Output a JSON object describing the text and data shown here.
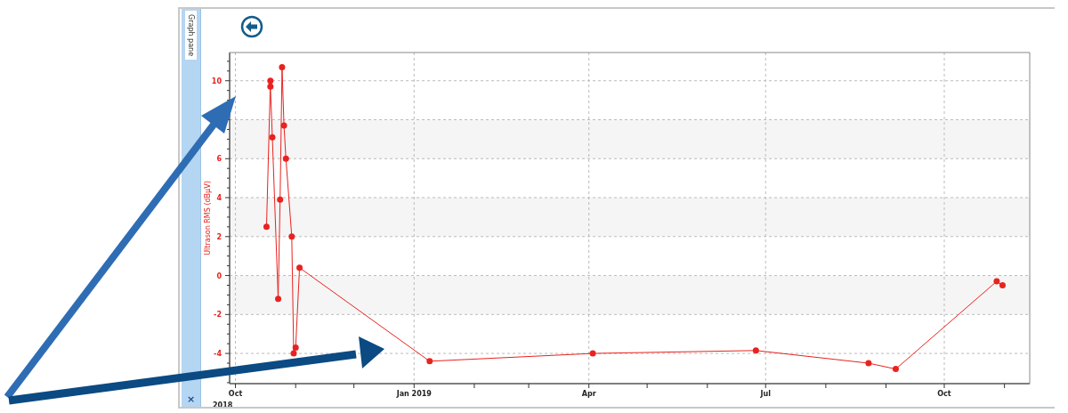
{
  "side_panel": {
    "tab": {
      "label": "Graph pane",
      "selected": true
    },
    "close": "×"
  },
  "graph": {
    "chart_data": {
      "type": "line",
      "ylabel": "Ultrason RMS (dBµV)",
      "x": [
        "2018-10-17",
        "2018-10-19",
        "2018-10-19",
        "2018-10-20",
        "2018-10-23",
        "2018-10-24",
        "2018-10-25",
        "2018-10-26",
        "2018-10-27",
        "2018-10-30",
        "2018-10-31",
        "2018-11-01",
        "2018-11-03",
        "2019-01-09",
        "2019-04-03",
        "2019-06-26",
        "2019-08-23",
        "2019-09-06",
        "2019-10-28",
        "2019-10-31"
      ],
      "grid": true,
      "series": [
        {
          "color": "#e8231f",
          "marker": "circle",
          "values": [
            2.5,
            10,
            9.7,
            7.1,
            -1.2,
            3.9,
            10.7,
            7.7,
            6,
            2,
            -4,
            -3.7,
            0.4,
            -4.4,
            -4,
            -3.85,
            -4.5,
            -4.8,
            -0.3,
            -0.5
          ]
        }
      ],
      "xlim": [
        "2018-09-28",
        "2019-11-14"
      ],
      "ylim": [
        -5.55,
        11.45
      ],
      "xticks": [
        {
          "value": "2018-10-01",
          "label": "Oct"
        },
        {
          "value": "2019-01-01",
          "label": "Jan 2019"
        },
        {
          "value": "2019-04-01",
          "label": "Apr"
        },
        {
          "value": "2019-07-01",
          "label": "Jul"
        },
        {
          "value": "2019-10-01",
          "label": "Oct"
        }
      ],
      "yticks": [
        -4,
        -2,
        0,
        2,
        4,
        6,
        10
      ]
    },
    "year_label": "2018"
  }
}
